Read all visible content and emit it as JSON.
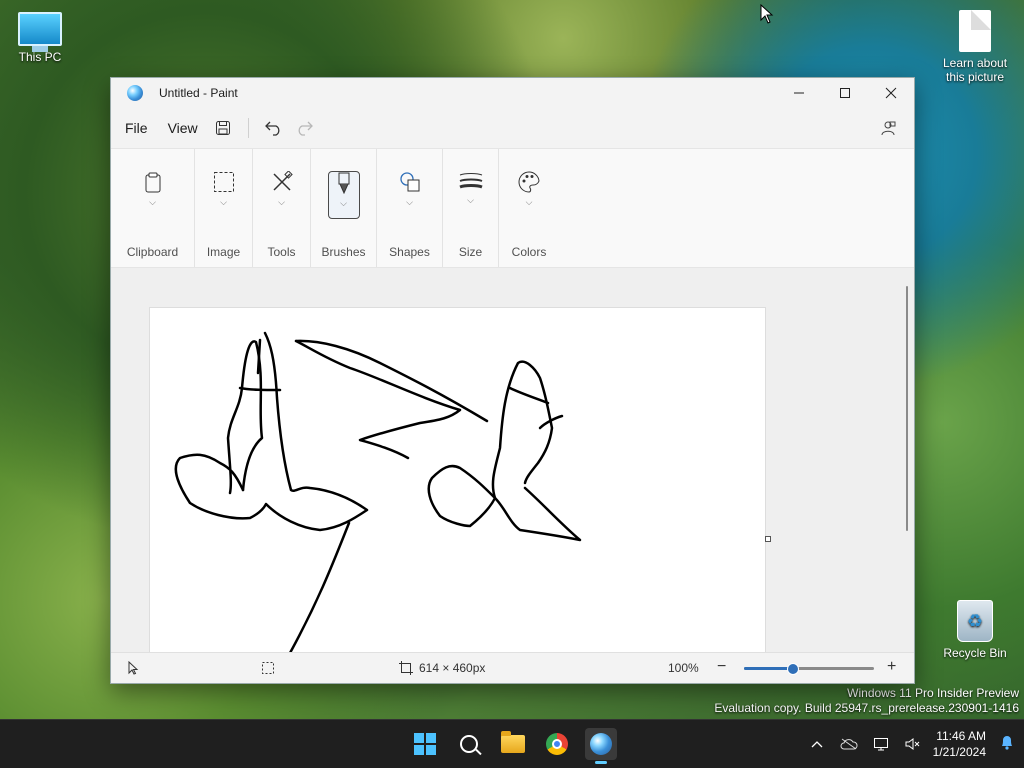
{
  "desktop": {
    "icons": [
      {
        "label": "This PC"
      },
      {
        "label": "Learn about this picture"
      },
      {
        "label": "Recycle Bin"
      }
    ],
    "watermark_line1": "Windows 11 Pro Insider Preview",
    "watermark_line2": "Evaluation copy. Build 25947.rs_prerelease.230901-1416"
  },
  "paint": {
    "window_title": "Untitled - Paint",
    "menu": {
      "file": "File",
      "view": "View"
    },
    "ribbon_groups": [
      {
        "label": "Clipboard",
        "icon": "clipboard-icon"
      },
      {
        "label": "Image",
        "icon": "selection-icon"
      },
      {
        "label": "Tools",
        "icon": "tools-icon"
      },
      {
        "label": "Brushes",
        "icon": "brush-icon"
      },
      {
        "label": "Shapes",
        "icon": "shapes-icon"
      },
      {
        "label": "Size",
        "icon": "size-icon"
      },
      {
        "label": "Colors",
        "icon": "palette-icon"
      }
    ],
    "status": {
      "canvas_size": "614 × 460px",
      "zoom": "100%",
      "zoom_fraction": 0.375
    }
  },
  "taskbar": {
    "time": "11:46 AM",
    "date": "1/21/2024",
    "colors": {
      "accent": "#4cc2ff",
      "bell": "#5ab4ff"
    }
  }
}
